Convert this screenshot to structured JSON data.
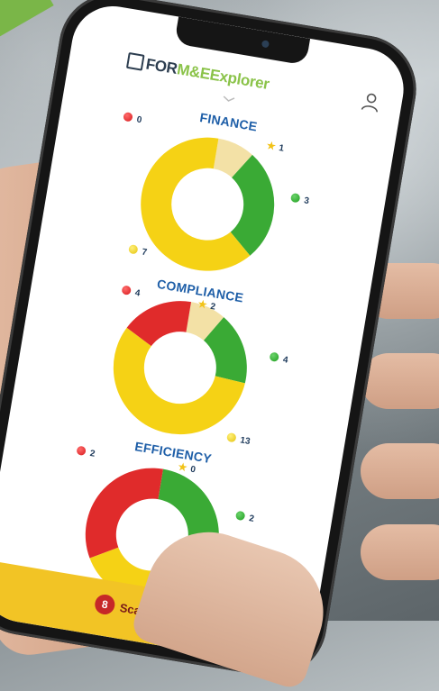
{
  "app": {
    "logo_for": "FOR",
    "logo_name": "M&EExplorer"
  },
  "sections": [
    {
      "title": "FINANCE",
      "legend": {
        "red": "0",
        "star": "1",
        "green": "3",
        "yellow": "7"
      },
      "values": {
        "red": 0,
        "star": 1,
        "green": 3,
        "yellow": 7
      }
    },
    {
      "title": "COMPLIANCE",
      "legend": {
        "red": "4",
        "star": "2",
        "green": "4",
        "yellow": "13"
      },
      "values": {
        "red": 4,
        "star": 2,
        "green": 4,
        "yellow": 13
      }
    },
    {
      "title": "EFFICIENCY",
      "legend": {
        "red": "2",
        "star": "0",
        "green": "2",
        "yellow": "2"
      },
      "values": {
        "red": 2,
        "star": 0,
        "green": 2,
        "yellow": 2
      }
    }
  ],
  "footer": {
    "badge": "8",
    "scan_label": "Scan"
  },
  "colors": {
    "red": "#e02b2b",
    "green": "#3aaa35",
    "yellow": "#f5d215",
    "star": "#f3e1a6",
    "title": "#1f5fa8",
    "footer": "#f2c425"
  }
}
